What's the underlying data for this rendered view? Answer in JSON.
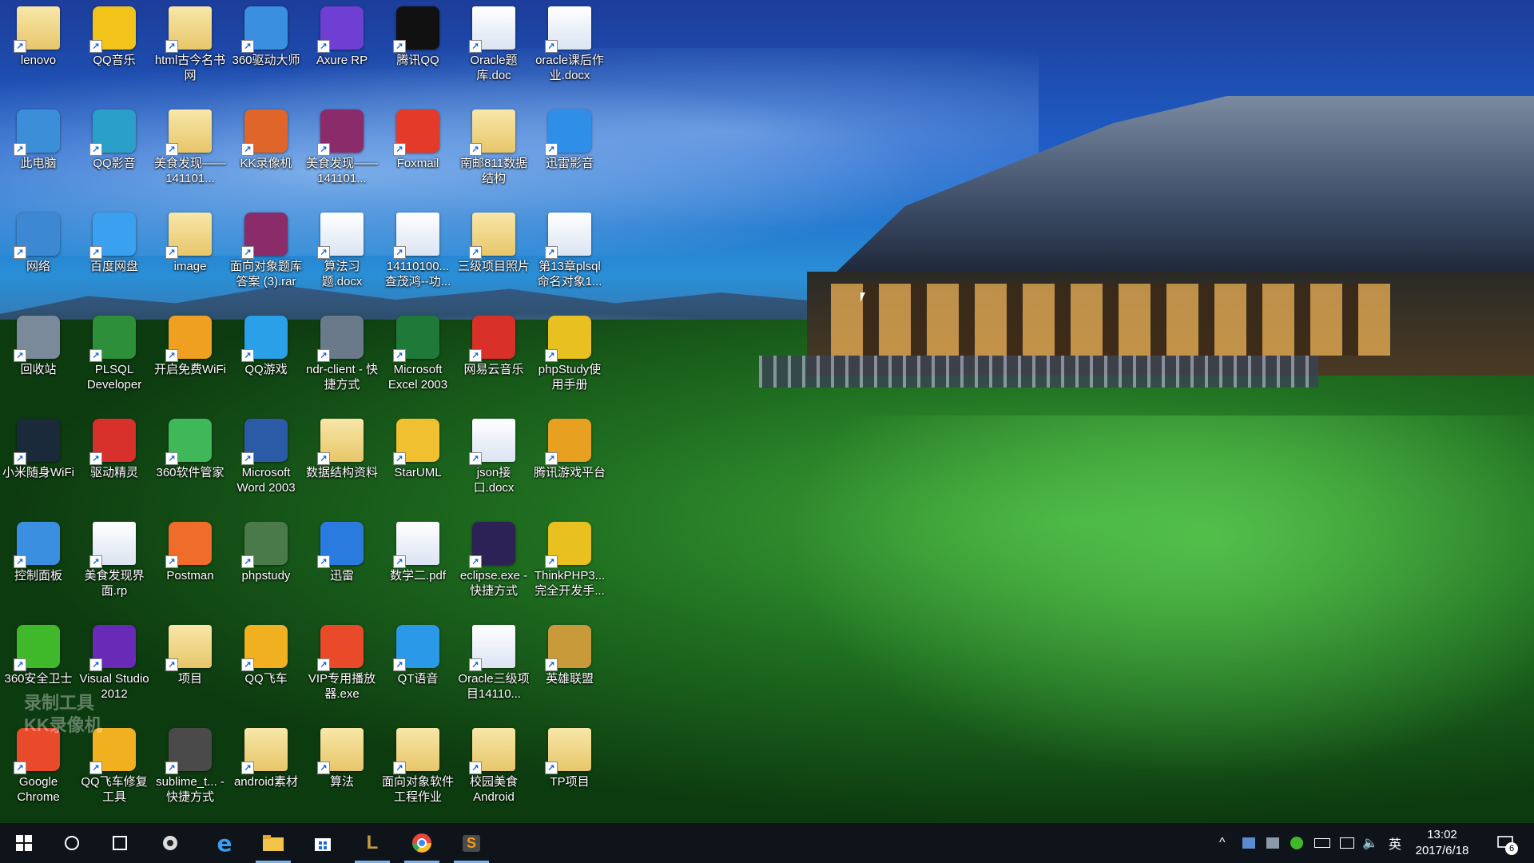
{
  "watermark": {
    "line1": "录制工具",
    "line2": "KK录像机"
  },
  "desktop": {
    "icons": [
      {
        "label": "lenovo",
        "type": "folder",
        "color": "#d9a74a"
      },
      {
        "label": "QQ音乐",
        "type": "app",
        "color": "#f2c318"
      },
      {
        "label": "html古今名书网",
        "type": "folder",
        "color": "#e7c66a"
      },
      {
        "label": "360驱动大师",
        "type": "app",
        "color": "#3a8fe0"
      },
      {
        "label": "Axure RP",
        "type": "app",
        "color": "#6f3fd3"
      },
      {
        "label": "腾讯QQ",
        "type": "app",
        "color": "#111111"
      },
      {
        "label": "Oracle题库.doc",
        "type": "doc",
        "color": "#2b5aa6"
      },
      {
        "label": "oracle课后作业.docx",
        "type": "doc",
        "color": "#2b5aa6"
      },
      {
        "label": "此电脑",
        "type": "app",
        "color": "#3b8fd8"
      },
      {
        "label": "QQ影音",
        "type": "app",
        "color": "#2a9fc9"
      },
      {
        "label": "美食发现——141101...",
        "type": "folder",
        "color": "#e7c66a"
      },
      {
        "label": "KK录像机",
        "type": "app",
        "color": "#e0652a"
      },
      {
        "label": "美食发现——141101...",
        "type": "app",
        "color": "#8a2b6a"
      },
      {
        "label": "Foxmail",
        "type": "app",
        "color": "#e33a2a"
      },
      {
        "label": "南邮811数据结构",
        "type": "folder",
        "color": "#e7c66a"
      },
      {
        "label": "迅雷影音",
        "type": "app",
        "color": "#2f8ee8"
      },
      {
        "label": "网络",
        "type": "app",
        "color": "#3c88d2"
      },
      {
        "label": "百度网盘",
        "type": "app",
        "color": "#3aa0f0"
      },
      {
        "label": "image",
        "type": "folder",
        "color": "#e7c66a"
      },
      {
        "label": "面向对象题库答案 (3).rar",
        "type": "app",
        "color": "#8a2b6a"
      },
      {
        "label": "算法习题.docx",
        "type": "doc",
        "color": "#2b5aa6"
      },
      {
        "label": "14110100...查茂鸿--功...",
        "type": "doc",
        "color": "#2b5aa6"
      },
      {
        "label": "三级项目照片",
        "type": "folder",
        "color": "#d96a20"
      },
      {
        "label": "第13章plsql命名对象1...",
        "type": "doc",
        "color": "#2b5aa6"
      },
      {
        "label": "回收站",
        "type": "app",
        "color": "#7a8a9a"
      },
      {
        "label": "PLSQL Developer",
        "type": "app",
        "color": "#2e8f3a"
      },
      {
        "label": "开启免费WiFi",
        "type": "app",
        "color": "#f0a020"
      },
      {
        "label": "QQ游戏",
        "type": "app",
        "color": "#2aa0e8"
      },
      {
        "label": "ndr-client - 快捷方式",
        "type": "app",
        "color": "#6a7a8a"
      },
      {
        "label": "Microsoft Excel 2003",
        "type": "app",
        "color": "#1f7a3a"
      },
      {
        "label": "网易云音乐",
        "type": "app",
        "color": "#d9302a"
      },
      {
        "label": "phpStudy使用手册",
        "type": "app",
        "color": "#e8c020"
      },
      {
        "label": "小米随身WiFi",
        "type": "app",
        "color": "#1a2a3a"
      },
      {
        "label": "驱动精灵",
        "type": "app",
        "color": "#d8302a"
      },
      {
        "label": "360软件管家",
        "type": "app",
        "color": "#3fb85a"
      },
      {
        "label": "Microsoft Word 2003",
        "type": "app",
        "color": "#2b5aa6"
      },
      {
        "label": "数据结构资料",
        "type": "folder",
        "color": "#e7c66a"
      },
      {
        "label": "StarUML",
        "type": "app",
        "color": "#f0c030"
      },
      {
        "label": "json接口.docx",
        "type": "doc",
        "color": "#2b5aa6"
      },
      {
        "label": "腾讯游戏平台",
        "type": "app",
        "color": "#e8a020"
      },
      {
        "label": "控制面板",
        "type": "app",
        "color": "#3a8fe0"
      },
      {
        "label": "美食发现界面.rp",
        "type": "doc",
        "color": "#888888"
      },
      {
        "label": "Postman",
        "type": "app",
        "color": "#ef6c2a"
      },
      {
        "label": "phpstudy",
        "type": "app",
        "color": "#4a7a4a"
      },
      {
        "label": "迅雷",
        "type": "app",
        "color": "#2a7ae0"
      },
      {
        "label": "数学二.pdf",
        "type": "doc",
        "color": "#2b5aa6"
      },
      {
        "label": "eclipse.exe - 快捷方式",
        "type": "app",
        "color": "#2c2255"
      },
      {
        "label": "ThinkPHP3...完全开发手...",
        "type": "app",
        "color": "#e8c020"
      },
      {
        "label": "360安全卫士",
        "type": "app",
        "color": "#3fb82a"
      },
      {
        "label": "Visual Studio 2012",
        "type": "app",
        "color": "#6a2ab8"
      },
      {
        "label": "项目",
        "type": "folder",
        "color": "#e7c66a"
      },
      {
        "label": "QQ飞车",
        "type": "app",
        "color": "#f0b020"
      },
      {
        "label": "VIP专用播放器.exe",
        "type": "app",
        "color": "#e84a2a"
      },
      {
        "label": "QT语音",
        "type": "app",
        "color": "#2a9ae8"
      },
      {
        "label": "Oracle三级项目14110...",
        "type": "doc",
        "color": "#2b5aa6"
      },
      {
        "label": "英雄联盟",
        "type": "app",
        "color": "#c89a3a"
      },
      {
        "label": "Google Chrome",
        "type": "app",
        "color": "#e84a2a"
      },
      {
        "label": "QQ飞车修复工具",
        "type": "app",
        "color": "#f0b020"
      },
      {
        "label": "sublime_t... - 快捷方式",
        "type": "app",
        "color": "#4a4a4a"
      },
      {
        "label": "android素材",
        "type": "folder",
        "color": "#e7c66a"
      },
      {
        "label": "算法",
        "type": "folder",
        "color": "#e7c66a"
      },
      {
        "label": "面向对象软件工程作业",
        "type": "folder",
        "color": "#e7c66a"
      },
      {
        "label": "校园美食Android",
        "type": "folder",
        "color": "#e7c66a"
      },
      {
        "label": "TP项目",
        "type": "folder",
        "color": "#e7c66a"
      }
    ]
  },
  "taskbar": {
    "start_icon": "windows-start-icon",
    "tray_chars": {
      "chevron": "^",
      "ime": "英"
    },
    "clock": {
      "time": "13:02",
      "date": "2017/6/18"
    },
    "notifications_count": "6"
  }
}
